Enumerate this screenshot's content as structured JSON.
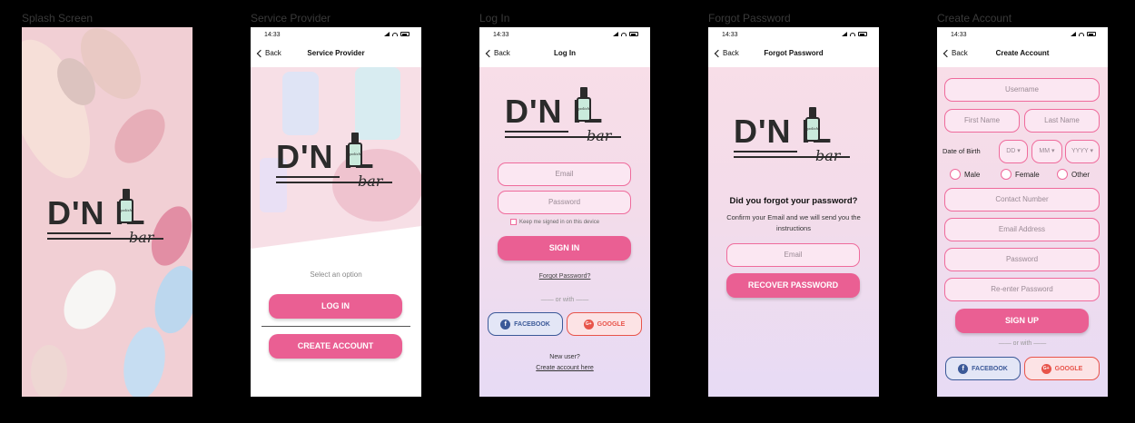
{
  "frames": {
    "splash": "Splash Screen",
    "provider": "Service Provider",
    "login": "Log In",
    "forgot": "Forgot Password",
    "create": "Create Account"
  },
  "status_time": "14:33",
  "nav": {
    "back": "Back",
    "provider_title": "Service Provider",
    "login_title": "Log In",
    "forgot_title": "Forgot Password",
    "create_title": "Create Account"
  },
  "logo": {
    "word": "D'N  IL",
    "sub": "bar",
    "bottle_text": "polish"
  },
  "provider": {
    "select": "Select an option",
    "login_btn": "LOG IN",
    "create_btn": "CREATE ACCOUNT"
  },
  "login": {
    "email": "Email",
    "password": "Password",
    "keep": "Keep me signed in on this device",
    "signin": "SIGN IN",
    "forgot": "Forgot Password?",
    "or_with": "—— or with ——",
    "facebook": "FACEBOOK",
    "google": "GOOGLE",
    "new_user": "New user?",
    "create_here": "Create account here"
  },
  "forgot": {
    "heading": "Did you forgot your password?",
    "desc": "Confirm your Email and we will send you the instructions",
    "email": "Email",
    "recover": "RECOVER PASSWORD"
  },
  "create": {
    "username": "Username",
    "first": "First Name",
    "last": "Last Name",
    "dob": "Date of Birth",
    "dd": "DD",
    "mm": "MM",
    "yyyy": "YYYY",
    "male": "Male",
    "female": "Female",
    "other": "Other",
    "contact": "Contact Number",
    "email": "Email Address",
    "password": "Password",
    "reenter": "Re-enter Password",
    "signup": "SIGN UP",
    "or_with": "—— or with ——",
    "facebook": "FACEBOOK",
    "google": "GOOGLE"
  },
  "colors": {
    "accent": "#ea5f93",
    "field_border": "#ef6b9c",
    "facebook": "#3b5998",
    "google": "#e8544a"
  }
}
